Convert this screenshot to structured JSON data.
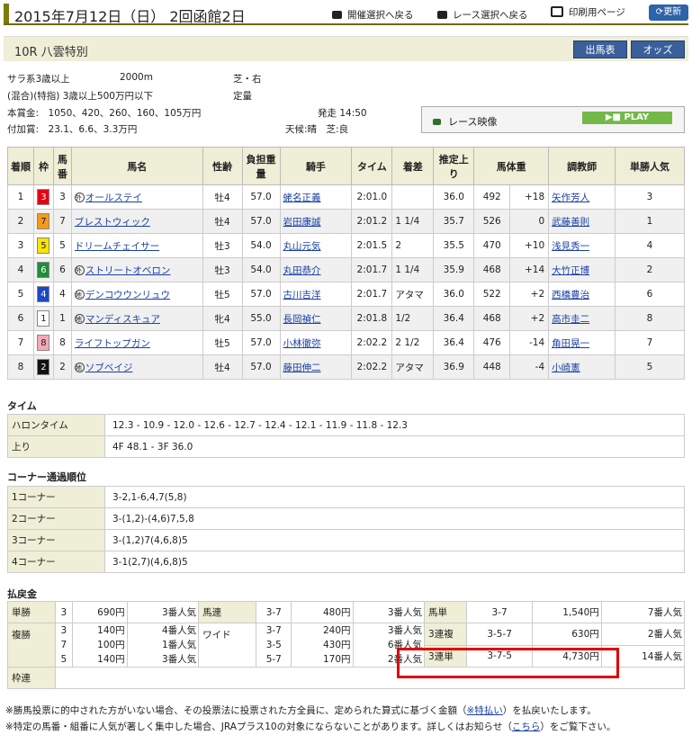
{
  "header": {
    "title": "2015年7月12日（日） 2回函館2日",
    "nav_kaisai": "開催選択へ戻る",
    "nav_race": "レース選択へ戻る",
    "nav_print": "印刷用ページ",
    "update": "更新"
  },
  "race": {
    "name": "10R 八雲特別",
    "btn_entry": "出馬表",
    "btn_odds": "オッズ",
    "cond1": "サラ系3歳以上",
    "distance": "2000m",
    "surface": "芝・右",
    "cond2": "(混合)(特指) 3歳以上500万円以下",
    "weight_rule": "定量",
    "prize": "本賞金:　1050、420、260、160、105万円",
    "start": "発走 14:50",
    "add_prize": "付加賞:　23.1、6.6、3.3万円",
    "weather": "天候:晴　芝:良",
    "video_label": "レース映像",
    "play": "PLAY"
  },
  "result_headers": [
    "着順",
    "枠",
    "馬番",
    "馬名",
    "性齢",
    "負担重量",
    "騎手",
    "タイム",
    "着差",
    "推定上り",
    "馬体重",
    "調教師",
    "単勝人気"
  ],
  "results": [
    {
      "pos": "1",
      "waku": "3",
      "no": "3",
      "mark": "外",
      "horse": "オールステイ",
      "sex": "牡4",
      "wt": "57.0",
      "jockey": "蛯名正義",
      "time": "2:01.0",
      "margin": "",
      "last": "36.0",
      "bw": "492",
      "diff": "+18",
      "trainer": "矢作芳人",
      "pop": "3"
    },
    {
      "pos": "2",
      "waku": "7",
      "no": "7",
      "mark": "",
      "horse": "ブレストウィック",
      "sex": "牡4",
      "wt": "57.0",
      "jockey": "岩田康誠",
      "time": "2:01.2",
      "margin": "1 1/4",
      "last": "35.7",
      "bw": "526",
      "diff": "0",
      "trainer": "武藤善則",
      "pop": "1"
    },
    {
      "pos": "3",
      "waku": "5",
      "no": "5",
      "mark": "",
      "horse": "ドリームチェイサー",
      "sex": "牡3",
      "wt": "54.0",
      "jockey": "丸山元気",
      "time": "2:01.5",
      "margin": "2",
      "last": "35.5",
      "bw": "470",
      "diff": "+10",
      "trainer": "浅見秀一",
      "pop": "4"
    },
    {
      "pos": "4",
      "waku": "6",
      "no": "6",
      "mark": "外",
      "horse": "ストリートオベロン",
      "sex": "牡3",
      "wt": "54.0",
      "jockey": "丸田恭介",
      "time": "2:01.7",
      "margin": "1 1/4",
      "last": "35.9",
      "bw": "468",
      "diff": "+14",
      "trainer": "大竹正博",
      "pop": "2"
    },
    {
      "pos": "5",
      "waku": "4",
      "no": "4",
      "mark": "地",
      "horse": "デンコウウンリュウ",
      "sex": "牡5",
      "wt": "57.0",
      "jockey": "古川吉洋",
      "time": "2:01.7",
      "margin": "アタマ",
      "last": "36.0",
      "bw": "522",
      "diff": "+2",
      "trainer": "西橋豊治",
      "pop": "6"
    },
    {
      "pos": "6",
      "waku": "1",
      "no": "1",
      "mark": "地",
      "horse": "マンディスキュア",
      "sex": "牝4",
      "wt": "55.0",
      "jockey": "長岡禎仁",
      "time": "2:01.8",
      "margin": "1/2",
      "last": "36.4",
      "bw": "468",
      "diff": "+2",
      "trainer": "高市圭二",
      "pop": "8"
    },
    {
      "pos": "7",
      "waku": "8",
      "no": "8",
      "mark": "",
      "horse": "ライフトップガン",
      "sex": "牡5",
      "wt": "57.0",
      "jockey": "小林徹弥",
      "time": "2:02.2",
      "margin": "2 1/2",
      "last": "36.4",
      "bw": "476",
      "diff": "-14",
      "trainer": "角田晃一",
      "pop": "7"
    },
    {
      "pos": "8",
      "waku": "2",
      "no": "2",
      "mark": "地",
      "horse": "ソブベイジ",
      "sex": "牡4",
      "wt": "57.0",
      "jockey": "藤田伸二",
      "time": "2:02.2",
      "margin": "アタマ",
      "last": "36.9",
      "bw": "448",
      "diff": "-4",
      "trainer": "小崎憲",
      "pop": "5"
    }
  ],
  "waku_colors": {
    "1": [
      "#ffffff",
      "#222222"
    ],
    "2": [
      "#111111",
      "#ffffff"
    ],
    "3": [
      "#e60012",
      "#ffffff"
    ],
    "4": [
      "#1a48c8",
      "#ffffff"
    ],
    "5": [
      "#f7e400",
      "#222222"
    ],
    "6": [
      "#1f8e3a",
      "#ffffff"
    ],
    "7": [
      "#f39a1e",
      "#222222"
    ],
    "8": [
      "#f5a8b8",
      "#222222"
    ]
  },
  "time_section": {
    "title": "タイム",
    "furlong_label": "ハロンタイム",
    "furlong": "12.3 - 10.9 - 12.0 - 12.6 - 12.7 - 12.4 - 12.1 - 11.9 - 11.8 - 12.3",
    "last_label": "上り",
    "last": "4F 48.1 - 3F 36.0"
  },
  "corner_section": {
    "title": "コーナー通過順位",
    "rows": [
      {
        "label": "1コーナー",
        "value": "3-2,1-6,4,7(5,8)"
      },
      {
        "label": "2コーナー",
        "value": "3-(1,2)-(4,6)7,5,8"
      },
      {
        "label": "3コーナー",
        "value": "3-(1,2)7(4,6,8)5"
      },
      {
        "label": "4コーナー",
        "value": "3-1(2,7)(4,6,8)5"
      }
    ]
  },
  "payout": {
    "title": "払戻金",
    "win": {
      "label": "単勝",
      "no": "3",
      "amt": "690円",
      "pop": "3番人気"
    },
    "place": {
      "label": "複勝",
      "no": [
        "3",
        "7",
        "5"
      ],
      "amt": [
        "140円",
        "100円",
        "140円"
      ],
      "pop": [
        "4番人気",
        "1番人気",
        "3番人気"
      ]
    },
    "bracket": {
      "label": "枠連"
    },
    "quinella": {
      "label": "馬連",
      "no": "3-7",
      "amt": "480円",
      "pop": "3番人気"
    },
    "wide": {
      "label": "ワイド",
      "no": [
        "3-7",
        "3-5",
        "5-7"
      ],
      "amt": [
        "240円",
        "430円",
        "170円"
      ],
      "pop": [
        "3番人気",
        "6番人気",
        "2番人気"
      ]
    },
    "exacta": {
      "label": "馬単",
      "no": "3-7",
      "amt": "1,540円",
      "pop": "7番人気"
    },
    "trio": {
      "label": "3連複",
      "no": "3-5-7",
      "amt": "630円",
      "pop": "2番人気"
    },
    "trifecta": {
      "label": "3連単",
      "no": "3-7-5",
      "amt": "4,730円",
      "pop": "14番人気"
    }
  },
  "notes": {
    "n1_a": "※勝馬投票に的中された方がいない場合、その投票法に投票された方全員に、定められた算式に基づく金額（",
    "n1_link": "※特払い",
    "n1_b": "）を払戻いたします。",
    "n2_a": "※特定の馬番・組番に人気が著しく集中した場合、JRAプラス10の対象にならないことがあります。詳しくはお知らせ（",
    "n2_link": "こちら",
    "n2_b": "）をご覧下さい。"
  }
}
